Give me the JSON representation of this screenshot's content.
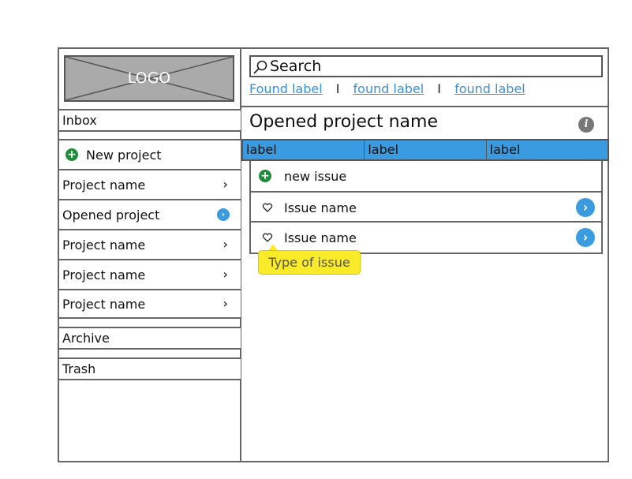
{
  "logo": {
    "text": "LOGO"
  },
  "sidebar": {
    "inbox": "Inbox",
    "new_project": "New project",
    "projects": [
      {
        "label": "Project name",
        "icon": "chevron-right-icon"
      },
      {
        "label": "Opened project",
        "icon": "chevron-circle-right-icon"
      },
      {
        "label": "Project name",
        "icon": "chevron-right-icon"
      },
      {
        "label": "Project name",
        "icon": "chevron-right-icon"
      },
      {
        "label": "Project name",
        "icon": "chevron-right-icon"
      }
    ],
    "archive": "Archive",
    "trash": "Trash"
  },
  "search": {
    "value": "Search",
    "results": [
      "Found label",
      "found label",
      "found label"
    ],
    "separator": "I"
  },
  "main": {
    "title": "Opened project name",
    "columns": [
      "label",
      "label",
      "label"
    ],
    "new_issue": "new issue",
    "issues": [
      "Issue name",
      "Issue name"
    ],
    "tooltip": "Type of issue"
  },
  "colors": {
    "accent": "#3b9be0",
    "add": "#1e8c3a",
    "tooltip": "#f9ea2a"
  }
}
